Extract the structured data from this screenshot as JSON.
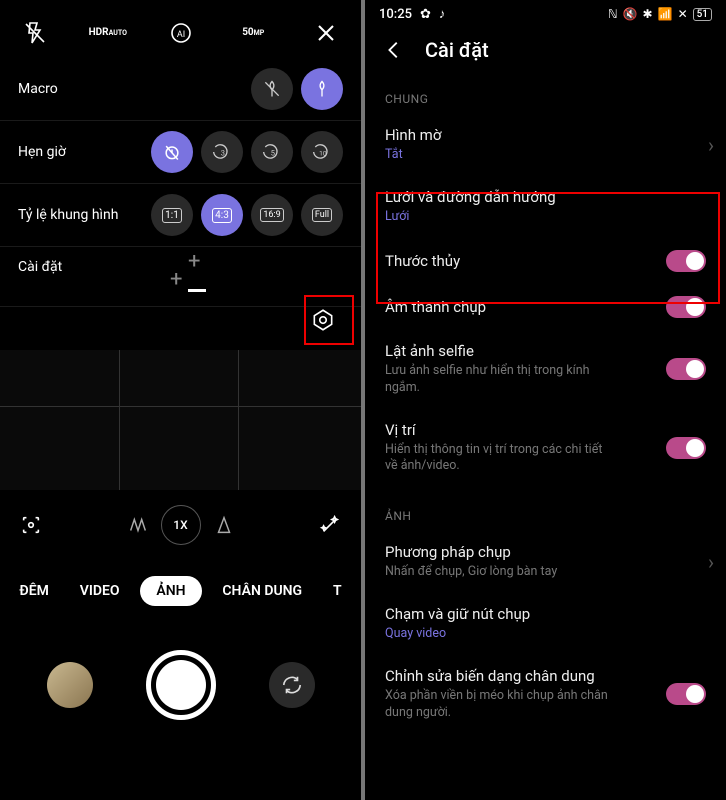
{
  "left": {
    "panel": {
      "macro": "Macro",
      "timer": "Hẹn giờ",
      "aspect": "Tỷ lệ khung hình",
      "settings": "Cài đặt"
    },
    "timer_options": [
      "off",
      "3",
      "5",
      "10"
    ],
    "aspect_options": [
      "1:1",
      "4:3",
      "16:9",
      "Full"
    ],
    "zoom": {
      "x": "1X"
    },
    "modes": {
      "night": "ĐÊM",
      "video": "VIDEO",
      "photo": "ẢNH",
      "portrait": "CHÂN DUNG"
    }
  },
  "right": {
    "status": {
      "time": "10:25",
      "battery": "51"
    },
    "header": "Cài đặt",
    "section_general": "CHUNG",
    "section_image": "ẢNH",
    "items": {
      "watermark": {
        "title": "Hình mờ",
        "sub": "Tắt"
      },
      "grid": {
        "title": "Lưới và đường dẫn hướng",
        "sub": "Lưới"
      },
      "level": {
        "title": "Thước thủy"
      },
      "shutter_sound": {
        "title": "Âm thanh chụp"
      },
      "mirror": {
        "title": "Lật ảnh selfie",
        "sub": "Lưu ảnh selfie như hiển thị trong kính ngắm."
      },
      "location": {
        "title": "Vị trí",
        "sub": "Hiển thị thông tin vị trí trong các chi tiết về ảnh/video."
      },
      "capture_method": {
        "title": "Phương pháp chụp",
        "sub": "Nhấn để chụp, Giơ lòng bàn tay"
      },
      "hold_shutter": {
        "title": "Chạm và giữ nút chụp",
        "sub": "Quay video"
      },
      "portrait_fix": {
        "title": "Chỉnh sửa biến dạng chân dung",
        "sub": "Xóa phần viền bị méo khi chụp ảnh chân dung người."
      }
    }
  }
}
